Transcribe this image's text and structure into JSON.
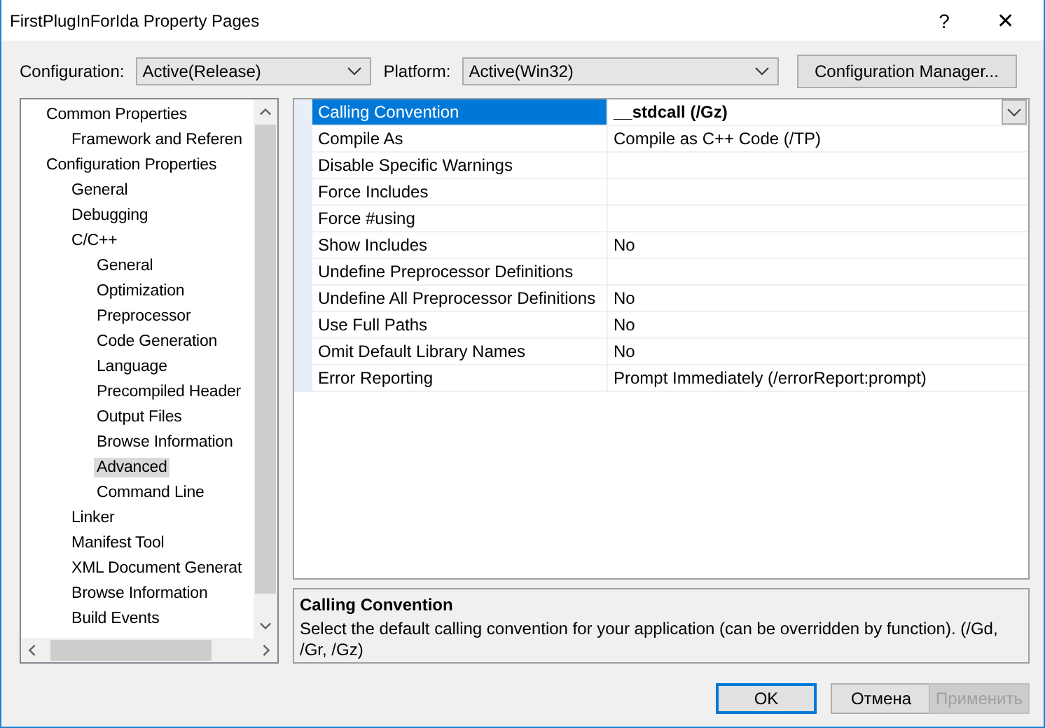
{
  "window": {
    "title": "FirstPlugInForIda Property Pages",
    "help": "?",
    "close": "✕"
  },
  "toolbar": {
    "configuration_label": "Configuration:",
    "configuration_value": "Active(Release)",
    "platform_label": "Platform:",
    "platform_value": "Active(Win32)",
    "manager_button": "Configuration Manager..."
  },
  "tree": {
    "items": [
      {
        "label": "Common Properties",
        "selected": false,
        "children": [
          {
            "label": "Framework and Referen",
            "selected": false
          }
        ]
      },
      {
        "label": "Configuration Properties",
        "selected": false,
        "children": [
          {
            "label": "General",
            "selected": false
          },
          {
            "label": "Debugging",
            "selected": false
          },
          {
            "label": "C/C++",
            "selected": false,
            "children": [
              {
                "label": "General",
                "selected": false
              },
              {
                "label": "Optimization",
                "selected": false
              },
              {
                "label": "Preprocessor",
                "selected": false
              },
              {
                "label": "Code Generation",
                "selected": false
              },
              {
                "label": "Language",
                "selected": false
              },
              {
                "label": "Precompiled Header",
                "selected": false
              },
              {
                "label": "Output Files",
                "selected": false
              },
              {
                "label": "Browse Information",
                "selected": false
              },
              {
                "label": "Advanced",
                "selected": true
              },
              {
                "label": "Command Line",
                "selected": false
              }
            ]
          },
          {
            "label": "Linker",
            "selected": false
          },
          {
            "label": "Manifest Tool",
            "selected": false
          },
          {
            "label": "XML Document Generat",
            "selected": false
          },
          {
            "label": "Browse Information",
            "selected": false
          },
          {
            "label": "Build Events",
            "selected": false
          }
        ]
      }
    ]
  },
  "properties": [
    {
      "name": "Calling Convention",
      "value": "__stdcall (/Gz)",
      "selected": true,
      "modified": true
    },
    {
      "name": "Compile As",
      "value": "Compile as C++ Code (/TP)",
      "selected": false,
      "modified": false
    },
    {
      "name": "Disable Specific Warnings",
      "selected": false
    },
    {
      "name": "Force Includes",
      "selected": false
    },
    {
      "name": "Force #using",
      "selected": false
    },
    {
      "name": "Show Includes",
      "value": "No",
      "selected": false,
      "modified": false
    },
    {
      "name": "Undefine Preprocessor Definitions",
      "selected": false
    },
    {
      "name": "Undefine All Preprocessor Definitions",
      "value": "No",
      "selected": false,
      "modified": false
    },
    {
      "name": "Use Full Paths",
      "value": "No",
      "selected": false,
      "modified": false
    },
    {
      "name": "Omit Default Library Names",
      "value": "No",
      "selected": false,
      "modified": false
    },
    {
      "name": "Error Reporting",
      "value": "Prompt Immediately (/errorReport:prompt)",
      "selected": false,
      "modified": false
    }
  ],
  "description": {
    "title": "Calling Convention",
    "text": "Select the default calling convention for your application (can be overridden by function). (/Gd, /Gr, /Gz)"
  },
  "buttons": [
    {
      "label": "OK",
      "default": true,
      "disabled": false
    },
    {
      "label": "Отмена",
      "default": false,
      "disabled": false
    },
    {
      "label": "Применить",
      "default": false,
      "disabled": true
    }
  ]
}
